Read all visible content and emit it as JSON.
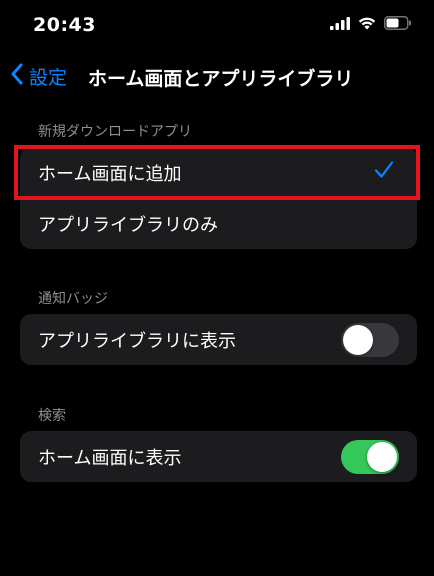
{
  "status_bar": {
    "time": "20:43",
    "icons": [
      "signal-icon",
      "wifi-icon",
      "battery-icon"
    ]
  },
  "nav": {
    "back_label": "設定",
    "title": "ホーム画面とアプリライブラリ",
    "accent_color": "#0a84ff"
  },
  "sections": {
    "new_app_downloads": {
      "header": "新規ダウンロードアプリ",
      "options": [
        {
          "label": "ホーム画面に追加",
          "selected": true
        },
        {
          "label": "アプリライブラリのみ",
          "selected": false
        }
      ]
    },
    "notification_badges": {
      "header": "通知バッジ",
      "row": {
        "label": "アプリライブラリに表示",
        "toggle_on": false
      }
    },
    "search": {
      "header": "検索",
      "row": {
        "label": "ホーム画面に表示",
        "toggle_on": true
      }
    }
  },
  "colors": {
    "background": "#000000",
    "group_background": "#1c1c1e",
    "toggle_on": "#34c759",
    "toggle_off": "#39393d",
    "highlight": "#e3141d"
  }
}
